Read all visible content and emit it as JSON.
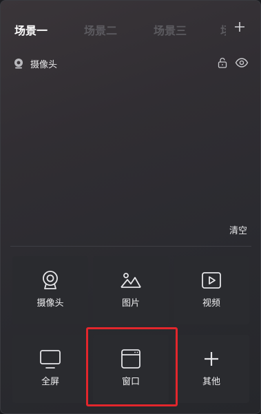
{
  "tabs": [
    {
      "label": "场景一",
      "active": true
    },
    {
      "label": "场景二",
      "active": false
    },
    {
      "label": "场景三",
      "active": false
    }
  ],
  "partial_tab_label": "场",
  "add_tab_icon": "plus-icon",
  "source": {
    "label": "摄像头",
    "icon": "camera-icon",
    "lock_icon": "unlock-icon",
    "visibility_icon": "eye-icon"
  },
  "clear_label": "清空",
  "add_source_tiles": [
    {
      "label": "摄像头",
      "icon": "webcam-icon"
    },
    {
      "label": "图片",
      "icon": "image-icon"
    },
    {
      "label": "视频",
      "icon": "video-icon"
    },
    {
      "label": "全屏",
      "icon": "monitor-icon"
    },
    {
      "label": "窗口",
      "icon": "window-icon"
    },
    {
      "label": "其他",
      "icon": "plus-icon"
    }
  ],
  "colors": {
    "active_text": "#ffffff",
    "inactive_text": "#5c5b60",
    "tile_bg": "#2a2b2f",
    "highlight": "#e3262c"
  }
}
